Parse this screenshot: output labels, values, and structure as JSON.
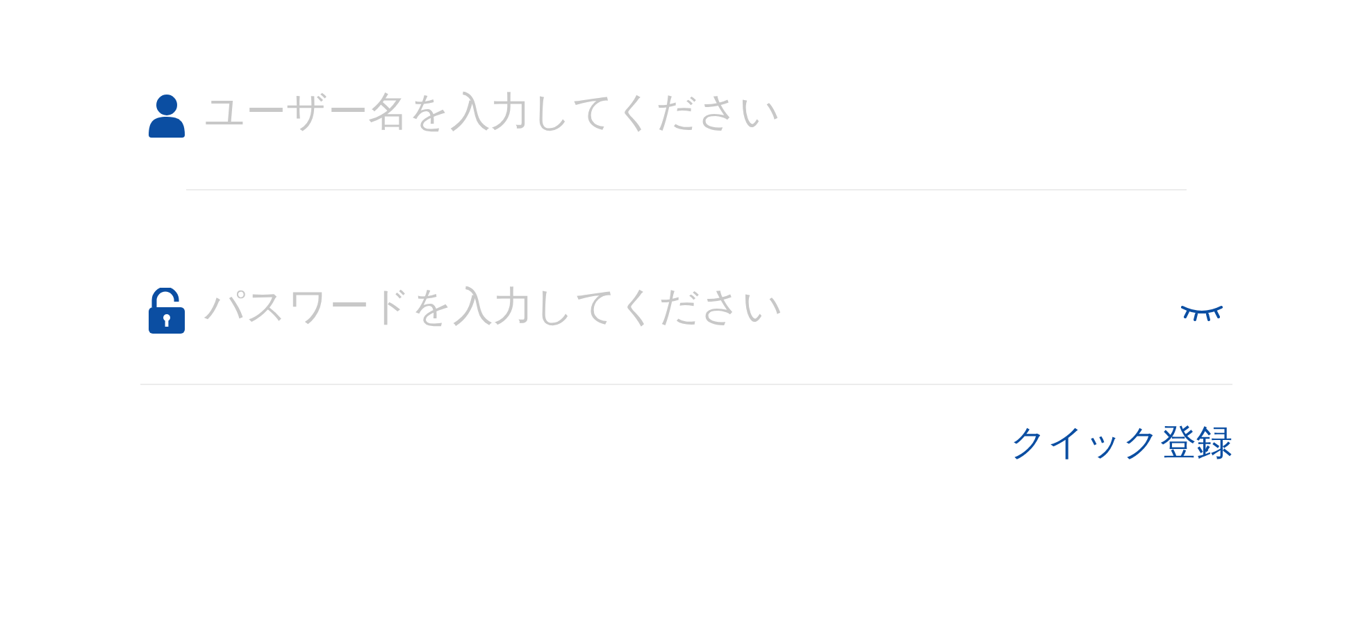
{
  "username": {
    "placeholder": "ユーザー名を入力してください"
  },
  "password": {
    "placeholder": "パスワードを入力してください"
  },
  "quick_register_link": "クイック登録"
}
